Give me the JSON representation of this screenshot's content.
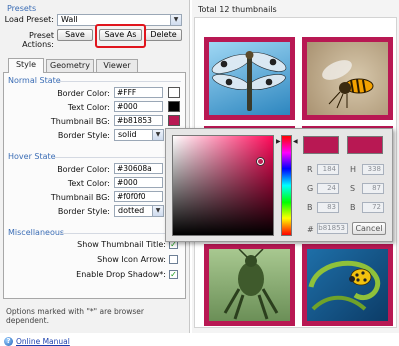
{
  "presets": {
    "title": "Presets",
    "load_label": "Load Preset:",
    "load_value": "Wall",
    "actions_label": "Preset Actions:",
    "save_label": "Save",
    "save_as_label": "Save As",
    "delete_label": "Delete"
  },
  "tabs": [
    {
      "label": "Style",
      "active": true
    },
    {
      "label": "Geometry",
      "active": false
    },
    {
      "label": "Viewer",
      "active": false
    }
  ],
  "normal_state": {
    "title": "Normal State",
    "border_color_label": "Border Color:",
    "border_color": "#FFF",
    "text_color_label": "Text Color:",
    "text_color": "#000",
    "thumb_bg_label": "Thumbnail BG:",
    "thumb_bg": "#b81853",
    "border_style_label": "Border Style:",
    "border_style": "solid"
  },
  "hover_state": {
    "title": "Hover State",
    "border_color_label": "Border Color:",
    "border_color": "#30608a",
    "text_color_label": "Text Color:",
    "text_color": "#000",
    "thumb_bg_label": "Thumbnail BG:",
    "thumb_bg": "#f0f0f0",
    "border_style_label": "Border Style:",
    "border_style": "dotted"
  },
  "misc": {
    "title": "Miscellaneous",
    "show_title_label": "Show Thumbnail Title:",
    "show_title_checked": true,
    "show_arrow_label": "Show Icon Arrow:",
    "show_arrow_checked": false,
    "drop_shadow_label": "Enable Drop Shadow*:",
    "drop_shadow_checked": true
  },
  "footnote": "Options marked with \"*\" are browser dependent.",
  "manual_link": "Online Manual",
  "total_label": "Total 12 thumbnails",
  "colors": {
    "accent": "#b81853",
    "hover_border": "#30608a",
    "highlight_red": "#e0151d",
    "link_blue": "#1a3fae"
  },
  "picker": {
    "r_label": "R",
    "r_value": "184",
    "g_label": "G",
    "g_value": "24",
    "b_label": "B",
    "b_value": "83",
    "h_label": "H",
    "h_value": "338",
    "s_label": "S",
    "s_value": "87",
    "bright_label": "B",
    "bright_value": "72",
    "hex_label": "#",
    "hex_value": "b81853",
    "cancel_label": "Cancel"
  }
}
